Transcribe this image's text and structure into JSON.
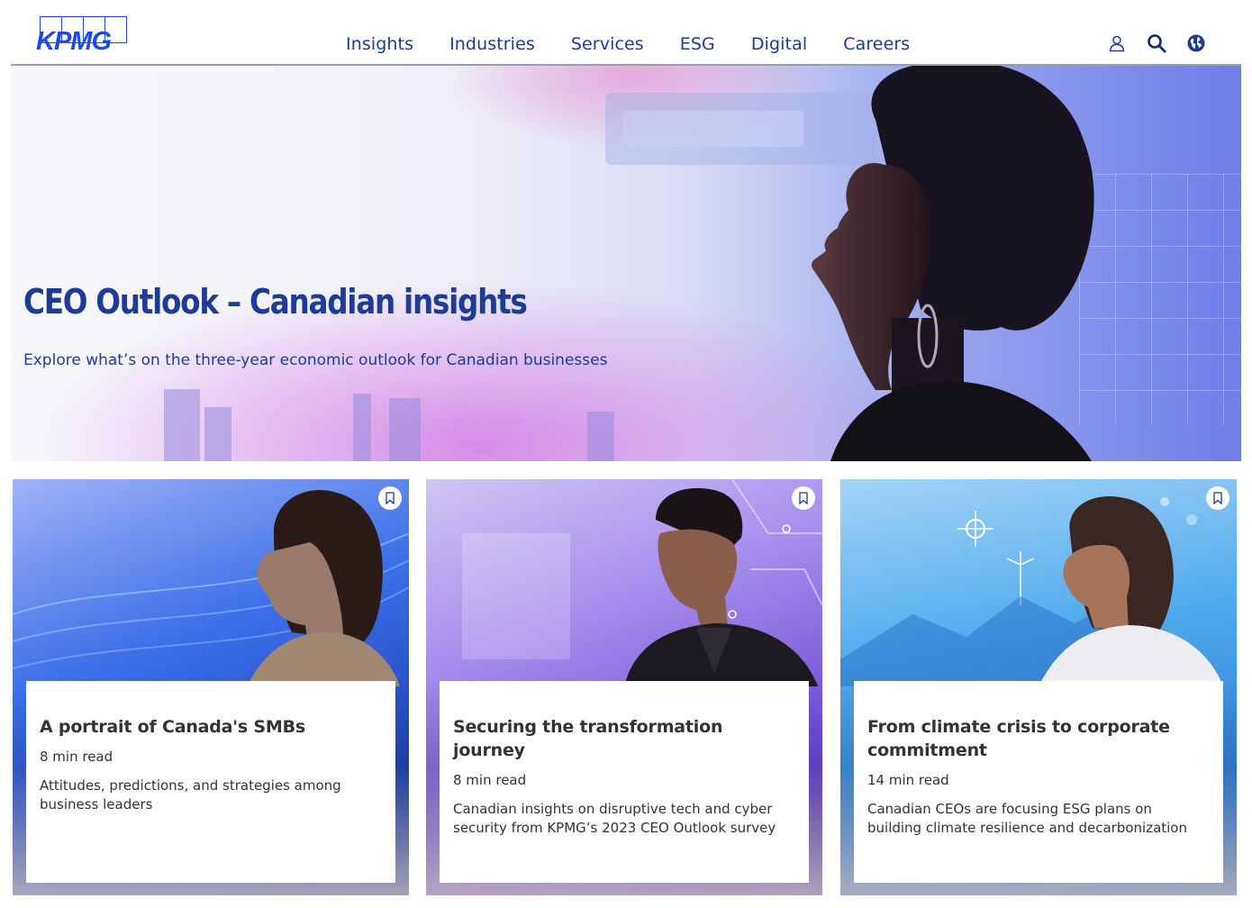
{
  "header": {
    "logo_text": "KPMG",
    "nav": [
      {
        "label": "Insights"
      },
      {
        "label": "Industries"
      },
      {
        "label": "Services"
      },
      {
        "label": "ESG"
      },
      {
        "label": "Digital"
      },
      {
        "label": "Careers"
      }
    ],
    "icons": [
      "user-icon",
      "search-icon",
      "globe-icon"
    ]
  },
  "hero": {
    "title": "CEO Outlook – Canadian insights",
    "subtitle": "Explore what’s on the three-year economic outlook for Canadian businesses"
  },
  "cards": [
    {
      "title": "A portrait of Canada's SMBs",
      "read_time": "8 min read",
      "description": "Attitudes, predictions, and strategies among business leaders"
    },
    {
      "title": "Securing the transformation journey",
      "read_time": "8 min read",
      "description": "Canadian insights on disruptive tech and cyber security from KPMG’s 2023 CEO Outlook survey"
    },
    {
      "title": "From climate crisis to corporate commitment",
      "read_time": "14 min read",
      "description": "Canadian CEOs are focusing ESG plans on building climate resilience and decarbonization"
    }
  ],
  "colors": {
    "brand_blue": "#1e49e2",
    "nav_text": "#1e3c96",
    "body_text": "#333333"
  }
}
